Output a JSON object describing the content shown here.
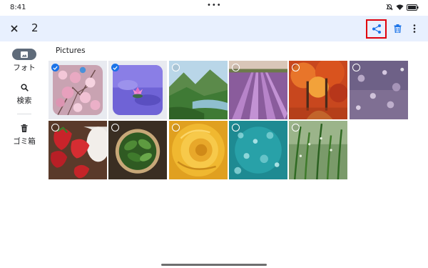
{
  "status_bar": {
    "time": "8:41",
    "center_dots": "•••"
  },
  "action_bar": {
    "selected_count": "2"
  },
  "nav": {
    "items": [
      {
        "label": "フォト",
        "icon": "photo-icon",
        "active": true
      },
      {
        "label": "検索",
        "icon": "search-icon",
        "active": false
      },
      {
        "label": "ゴミ箱",
        "icon": "trash-icon",
        "active": false
      }
    ]
  },
  "section": {
    "title": "Pictures"
  },
  "photos": [
    {
      "name": "cherry-blossom",
      "selected": true
    },
    {
      "name": "lotus-flower",
      "selected": true
    },
    {
      "name": "green-valley-lake",
      "selected": false
    },
    {
      "name": "lavender-field",
      "selected": false
    },
    {
      "name": "autumn-forest",
      "selected": false
    },
    {
      "name": "bokeh-lights",
      "selected": false
    },
    {
      "name": "strawberries",
      "selected": false
    },
    {
      "name": "basil-bowl",
      "selected": false
    },
    {
      "name": "yellow-rose",
      "selected": false
    },
    {
      "name": "water-drops",
      "selected": false
    },
    {
      "name": "grass-dew",
      "selected": false
    }
  ],
  "colors": {
    "accent": "#1a73e8",
    "highlight": "#e0000b",
    "action_bar_bg": "#e8f0fe"
  }
}
